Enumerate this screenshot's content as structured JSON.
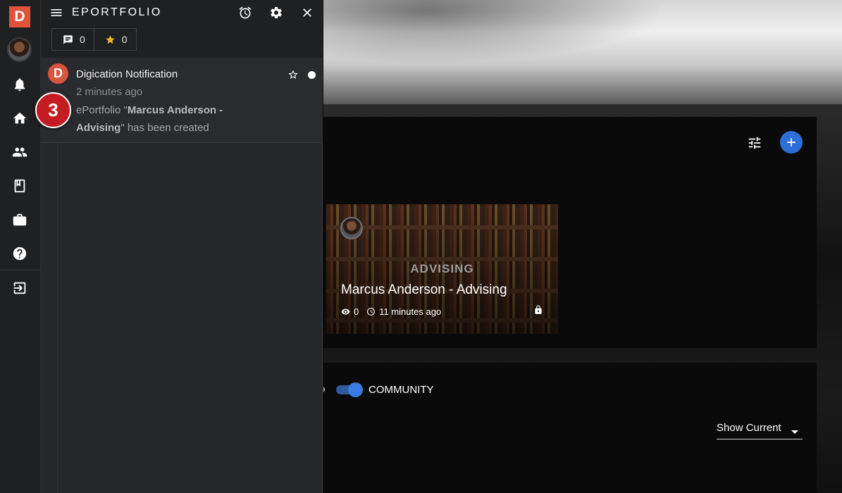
{
  "rail": {
    "logo": "D",
    "icons": [
      "bell-icon",
      "home-icon",
      "people-icon",
      "book-icon",
      "briefcase-icon",
      "help-icon",
      "logout-icon"
    ]
  },
  "panel": {
    "title": "EPORTFOLIO",
    "comments_count": "0",
    "stars_count": "0",
    "notification": {
      "avatar_letter": "D",
      "title": "Digication Notification",
      "time": "2 minutes ago",
      "body_prefix": "ePortfolio \"",
      "body_bold": "Marcus Anderson - Advising",
      "body_suffix": "\" has been created"
    },
    "step_badge": "3"
  },
  "main": {
    "card": {
      "tag": "ADVISING",
      "title": "Marcus Anderson - Advising",
      "views": "0",
      "updated": "11 minutes ago"
    },
    "community_label": "COMMUNITY",
    "show_select_label": "Show Current"
  },
  "colors": {
    "logo": "#e1523d",
    "accent_blue": "#2d6fd8",
    "step_badge_red": "#c51b22",
    "panel_bg": "#26272a",
    "rail_bg": "#1f2022"
  }
}
